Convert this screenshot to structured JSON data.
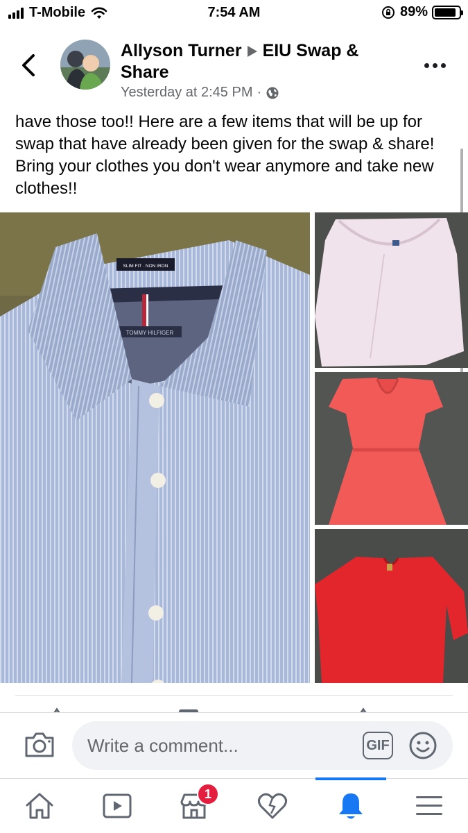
{
  "status_bar": {
    "carrier": "T-Mobile",
    "time": "7:54 AM",
    "battery_percent": "89%",
    "battery_level": 0.89
  },
  "post": {
    "author": "Allyson Turner",
    "group": "EIU Swap & Share",
    "timestamp": "Yesterday at 2:45 PM",
    "separator": "·",
    "privacy_icon": "globe-icon",
    "text": "have those too!! Here are a few items that will be up for swap that have already been given for the swap & share! Bring your clothes you don't wear anymore and take new clothes!!"
  },
  "photos": [
    {
      "name": "blue pinstripe button-down shirt",
      "label": "SLIM FIT · NON IRON",
      "brand": "TOMMY HILFIGER"
    },
    {
      "name": "white sheer blouse"
    },
    {
      "name": "coral lace dress"
    },
    {
      "name": "red blouse"
    }
  ],
  "comment_bar": {
    "placeholder": "Write a comment...",
    "gif_label": "GIF"
  },
  "bottom_nav": {
    "items": [
      {
        "icon": "home-icon"
      },
      {
        "icon": "watch-icon"
      },
      {
        "icon": "marketplace-icon",
        "badge": "1"
      },
      {
        "icon": "heart-icon"
      },
      {
        "icon": "bell-icon",
        "active": true
      },
      {
        "icon": "menu-icon"
      }
    ]
  },
  "colors": {
    "accent": "#1877f2",
    "badge": "#e41e3f",
    "secondary_text": "#65676b"
  }
}
